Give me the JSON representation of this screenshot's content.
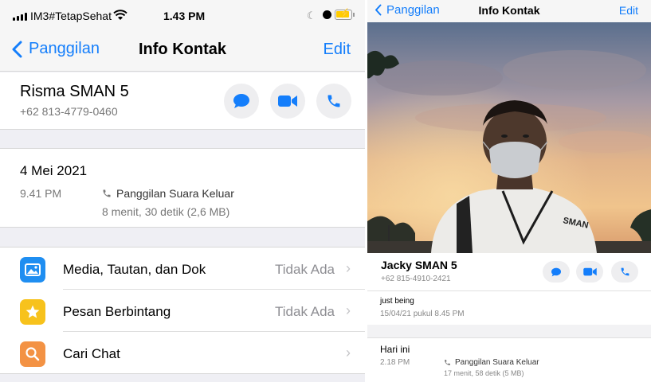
{
  "status_bar": {
    "carrier": "IM3#TetapSehat",
    "time": "1.43 PM"
  },
  "left": {
    "nav": {
      "back_label": "Panggilan",
      "title": "Info Kontak",
      "edit_label": "Edit"
    },
    "contact": {
      "name": "Risma SMAN 5",
      "phone": "+62 813-4779-0460"
    },
    "actions": [
      {
        "icon": "message-icon"
      },
      {
        "icon": "video-icon"
      },
      {
        "icon": "phone-icon"
      }
    ],
    "call_log": {
      "date": "4 Mei 2021",
      "time": "9.41 PM",
      "type": "Panggilan Suara Keluar",
      "duration": "8 menit, 30 detik (2,6 MB)"
    },
    "menu": [
      {
        "label": "Media, Tautan, dan Dok",
        "value": "Tidak Ada",
        "icon": "photo-icon",
        "color": "#1f8ef1"
      },
      {
        "label": "Pesan Berbintang",
        "value": "Tidak Ada",
        "icon": "star-icon",
        "color": "#f7c21c"
      },
      {
        "label": "Cari Chat",
        "value": "",
        "icon": "search-icon",
        "color": "#f39244"
      }
    ]
  },
  "right": {
    "nav": {
      "back_label": "Panggilan",
      "title": "Info Kontak",
      "edit_label": "Edit"
    },
    "contact": {
      "name": "Jacky SMAN 5",
      "phone": "+62 815-4910-2421"
    },
    "about": {
      "text": "just being",
      "date": "15/04/21 pukul 8.45 PM"
    },
    "call_log": {
      "date": "Hari ini",
      "time": "2.18 PM",
      "type": "Panggilan Suara Keluar",
      "duration": "17 menit, 58 detik (5 MB)"
    }
  },
  "colors": {
    "accent": "#147efb",
    "background": "#efeff4"
  }
}
